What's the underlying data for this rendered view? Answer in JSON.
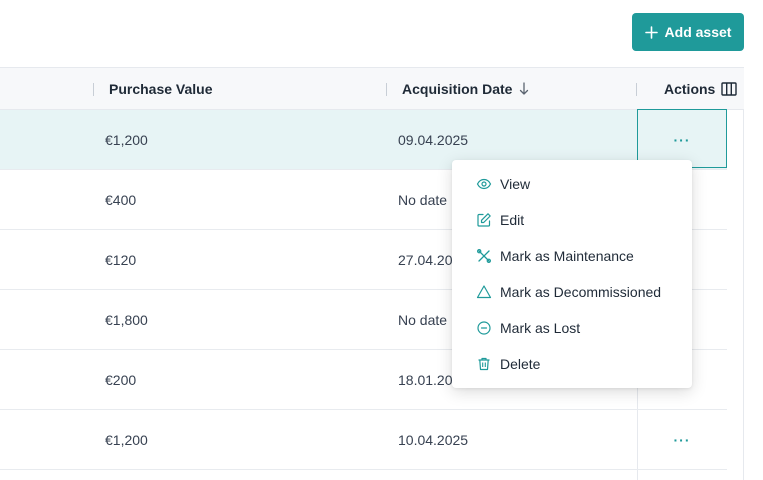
{
  "toolbar": {
    "add_label": "Add asset"
  },
  "table": {
    "headers": {
      "purchase_value": "Purchase Value",
      "acquisition_date": "Acquisition Date",
      "actions": "Actions"
    },
    "rows": [
      {
        "value": "€1,200",
        "date": "09.04.2025",
        "selected": true
      },
      {
        "value": "€400",
        "date": "No date"
      },
      {
        "value": "€120",
        "date": "27.04.20"
      },
      {
        "value": "€1,800",
        "date": "No date"
      },
      {
        "value": "€200",
        "date": "18.01.20"
      },
      {
        "value": "€1,200",
        "date": "10.04.2025"
      }
    ],
    "more_label": "···"
  },
  "menu": {
    "items": [
      {
        "label": "View",
        "icon": "eye-icon"
      },
      {
        "label": "Edit",
        "icon": "edit-icon"
      },
      {
        "label": "Mark as Maintenance",
        "icon": "wrench-icon"
      },
      {
        "label": "Mark as Decommissioned",
        "icon": "warning-icon"
      },
      {
        "label": "Mark as Lost",
        "icon": "minus-circle-icon"
      },
      {
        "label": "Delete",
        "icon": "trash-icon"
      }
    ]
  },
  "colors": {
    "accent": "#1f9a9a",
    "selected_row": "#e7f4f5"
  }
}
